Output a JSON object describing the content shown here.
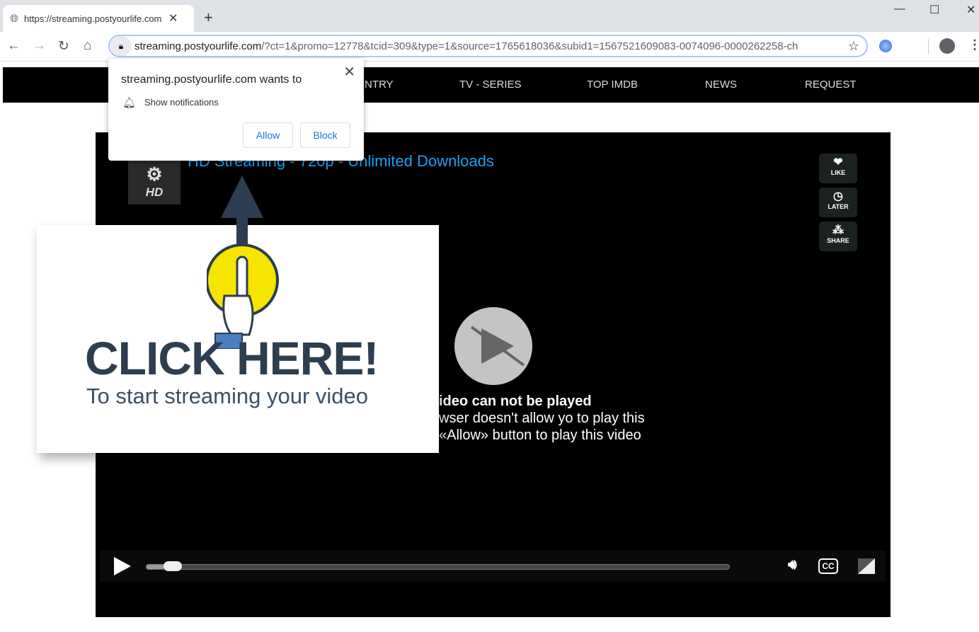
{
  "browser": {
    "tab_title": "https://streaming.postyourlife.com",
    "url_host": "streaming.postyourlife.com",
    "url_rest": "/?ct=1&promo=12778&tcid=309&type=1&source=1765618036&subid1=1567521609083-0074096-0000262258-ch"
  },
  "nav": {
    "items": [
      "NTRY",
      "TV - SERIES",
      "TOP IMDB",
      "NEWS",
      "REQUEST"
    ]
  },
  "player": {
    "logo": "HD",
    "title": "HD Streaming - 720p - Unlimited Downloads",
    "side": [
      "LIKE",
      "LATER",
      "SHARE"
    ],
    "msg1": "ideo can not be played",
    "msg2": "wser doesn't allow yo to play this",
    "msg3": "«Allow» button to play this video",
    "cc": "CC",
    "progress": 0.03
  },
  "overlay": {
    "headline": "CLICK HERE!",
    "subline": "To start streaming your video"
  },
  "popup": {
    "heading": "streaming.postyourlife.com wants to",
    "permission": "Show notifications",
    "allow": "Allow",
    "block": "Block"
  }
}
